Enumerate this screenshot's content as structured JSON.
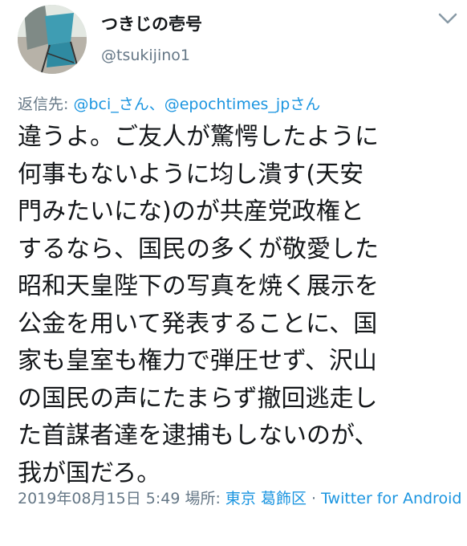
{
  "author": {
    "display_name": "つきじの壱号",
    "handle": "@tsukijino1"
  },
  "reply": {
    "prefix": "返信先: ",
    "to": "@bci_さん、@epochtimes_jpさん"
  },
  "tweet": {
    "lines": [
      "違うよ。ご友人が驚愕したように",
      "何事もないように均し潰す(天安",
      "門みたいにな)のが共産党政権と",
      "するなら、国民の多くが敬愛した",
      "昭和天皇陛下の写真を焼く展示を",
      "公金を用いて発表することに、国",
      "家も皇室も権力で弾圧せず、沢山",
      "の国民の声にたまらず撤回逃走し",
      "た首謀者達を逮捕もしないのが、",
      "我が国だろ。"
    ]
  },
  "meta": {
    "timestamp": "2019年08月15日 5:49",
    "location_prefix": " 場所: ",
    "location": "東京 葛飾区",
    "separator": " · ",
    "source": "Twitter for Android"
  },
  "icons": [
    "avatar-image",
    "chevron-down-icon"
  ],
  "colors": {
    "link": "#1b95e0",
    "secondary_text": "#657786",
    "primary_text": "#14171a"
  }
}
